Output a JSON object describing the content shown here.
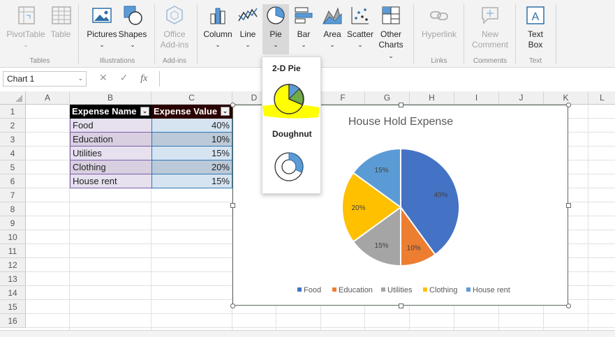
{
  "ribbon": {
    "tables": {
      "group_label": "Tables",
      "pivottable": "PivotTable",
      "table": "Table"
    },
    "illustrations": {
      "group_label": "Illustrations",
      "pictures": "Pictures",
      "shapes": "Shapes"
    },
    "addins": {
      "group_label": "Add-ins",
      "office_line1": "Office",
      "office_line2": "Add-ins"
    },
    "charts": {
      "column": "Column",
      "line": "Line",
      "pie": "Pie",
      "bar": "Bar",
      "area": "Area",
      "scatter": "Scatter",
      "other_line1": "Other",
      "other_line2": "Charts"
    },
    "links": {
      "group_label": "Links",
      "hyperlink": "Hyperlink"
    },
    "comments": {
      "group_label": "Comments",
      "new_line1": "New",
      "new_line2": "Comment"
    },
    "text": {
      "group_label": "Text",
      "textbox_line1": "Text",
      "textbox_line2": "Box"
    }
  },
  "formula_bar": {
    "name_box": "Chart 1",
    "fx": "fx",
    "value": ""
  },
  "columns": [
    "A",
    "B",
    "C",
    "D",
    "E",
    "F",
    "G",
    "H",
    "I",
    "J",
    "K",
    "L"
  ],
  "rows": [
    "1",
    "2",
    "3",
    "4",
    "5",
    "6",
    "7",
    "8",
    "9",
    "10",
    "11",
    "12",
    "13",
    "14",
    "15",
    "16"
  ],
  "table": {
    "headers": [
      "Expense Name",
      "Expense Value"
    ],
    "rows": [
      {
        "name": "Food",
        "value": "40%"
      },
      {
        "name": "Education",
        "value": "10%"
      },
      {
        "name": "Utilities",
        "value": "15%"
      },
      {
        "name": "Clothing",
        "value": "20%"
      },
      {
        "name": "House rent",
        "value": "15%"
      }
    ]
  },
  "dropdown": {
    "section1": "2-D Pie",
    "section2": "Doughnut"
  },
  "chart_data": {
    "type": "pie",
    "title": "House Hold Expense",
    "categories": [
      "Food",
      "Education",
      "Utilities",
      "Clothing",
      "House rent"
    ],
    "values": [
      40,
      10,
      15,
      20,
      15
    ],
    "labels": [
      "40%",
      "10%",
      "15%",
      "20%",
      "15%"
    ],
    "colors": [
      "#4472c4",
      "#ed7d31",
      "#a5a5a5",
      "#ffc000",
      "#5b9bd5"
    ],
    "legend_position": "bottom"
  }
}
